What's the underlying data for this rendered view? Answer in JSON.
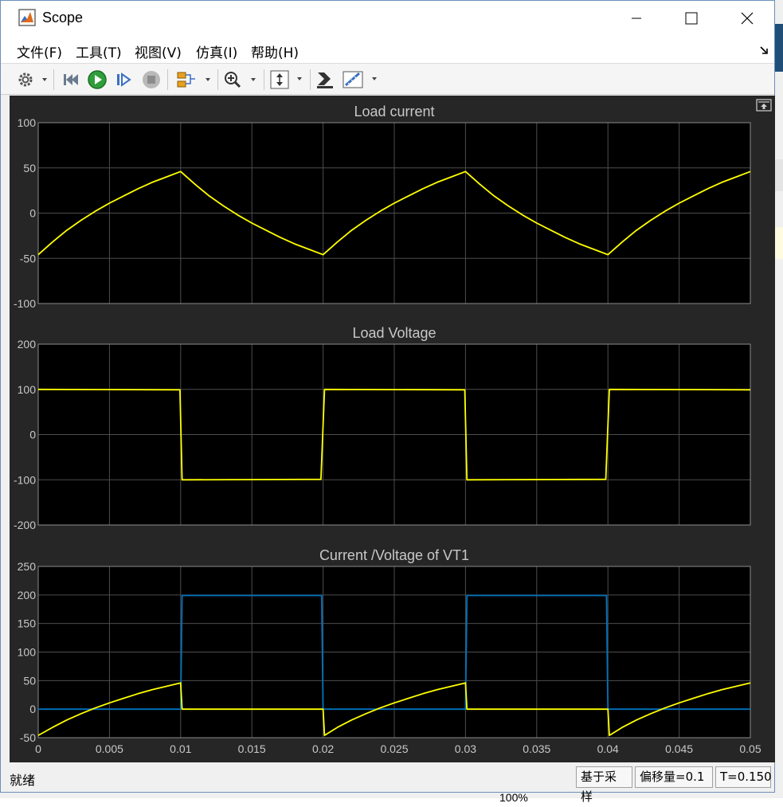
{
  "window": {
    "title": "Scope",
    "minimize_glyph": "—",
    "maximize_glyph": "☐",
    "close_glyph": "✕"
  },
  "background": {
    "bottom_text": "100%"
  },
  "menu": [
    {
      "label": "文件(F)"
    },
    {
      "label": "工具(T)"
    },
    {
      "label": "视图(V)"
    },
    {
      "label": "仿真(I)"
    },
    {
      "label": "帮助(H)"
    }
  ],
  "toolbar": {
    "icons": [
      "gear-icon",
      "step-back-icon",
      "run-icon",
      "step-forward-icon",
      "stop-icon",
      "signal-selector-icon",
      "zoom-icon",
      "autoscale-icon",
      "style-icon",
      "measurements-icon"
    ]
  },
  "status": {
    "text": "就绪",
    "sample_based": "基于采样",
    "offset": "偏移量=0.1",
    "time": "T=0.150"
  },
  "colors": {
    "plot_bg": "#000000",
    "figure_bg": "#262626",
    "grid": "#4d4d4d",
    "series_yellow": "#ffff00",
    "series_blue": "#0072bd",
    "text": "#c8c8c8"
  },
  "chart_data": [
    {
      "type": "line",
      "title": "Load current",
      "xlim": [
        0,
        0.05
      ],
      "ylim": [
        -100,
        100
      ],
      "yticks": [
        "100",
        "50",
        "0",
        "-50",
        "-100"
      ],
      "ytick_values": [
        100,
        50,
        0,
        -50,
        -100
      ],
      "xticks": [],
      "grid": true,
      "series": [
        {
          "color": "#ffff00",
          "x": [
            0,
            0.001,
            0.002,
            0.003,
            0.004,
            0.005,
            0.006,
            0.007,
            0.008,
            0.009,
            0.01,
            0.011,
            0.012,
            0.013,
            0.014,
            0.015,
            0.016,
            0.017,
            0.018,
            0.019,
            0.02,
            0.021,
            0.022,
            0.023,
            0.024,
            0.025,
            0.026,
            0.027,
            0.028,
            0.029,
            0.03,
            0.031,
            0.032,
            0.033,
            0.034,
            0.035,
            0.036,
            0.037,
            0.038,
            0.039,
            0.04,
            0.041,
            0.042,
            0.043,
            0.044,
            0.045,
            0.046,
            0.047,
            0.048,
            0.049,
            0.05
          ],
          "y": [
            -46,
            -32,
            -19,
            -8,
            2,
            11,
            19,
            27,
            34,
            40,
            46,
            32,
            19,
            8,
            -2,
            -11,
            -19,
            -27,
            -34,
            -40,
            -46,
            -32,
            -19,
            -8,
            2,
            11,
            19,
            27,
            34,
            40,
            46,
            32,
            19,
            8,
            -2,
            -11,
            -19,
            -27,
            -34,
            -40,
            -46,
            -32,
            -19,
            -8,
            2,
            11,
            19,
            27,
            34,
            40,
            46
          ]
        }
      ]
    },
    {
      "type": "line",
      "title": "Load Voltage",
      "xlim": [
        0,
        0.05
      ],
      "ylim": [
        -200,
        200
      ],
      "yticks": [
        "200",
        "100",
        "0",
        "-100",
        "-200"
      ],
      "ytick_values": [
        200,
        100,
        0,
        -100,
        -200
      ],
      "xticks": [],
      "grid": true,
      "series": [
        {
          "color": "#ffff00",
          "x": [
            0,
            0.00995,
            0.0101,
            0.01985,
            0.0201,
            0.02995,
            0.0301,
            0.03985,
            0.0401,
            0.05
          ],
          "y": [
            100,
            99,
            -100,
            -99,
            100,
            99,
            -100,
            -99,
            100,
            99
          ]
        }
      ]
    },
    {
      "type": "line",
      "title": "Current /Voltage of VT1",
      "xlim": [
        0,
        0.05
      ],
      "ylim": [
        -50,
        250
      ],
      "yticks": [
        "250",
        "200",
        "150",
        "100",
        "50",
        "0",
        "-50"
      ],
      "ytick_values": [
        250,
        200,
        150,
        100,
        50,
        0,
        -50
      ],
      "xticks": [
        "0",
        "0.005",
        "0.01",
        "0.015",
        "0.02",
        "0.025",
        "0.03",
        "0.035",
        "0.04",
        "0.045",
        "0.05"
      ],
      "xtick_values": [
        0,
        0.005,
        0.01,
        0.015,
        0.02,
        0.025,
        0.03,
        0.035,
        0.04,
        0.045,
        0.05
      ],
      "grid": true,
      "series": [
        {
          "color": "#0072bd",
          "x": [
            0,
            0.01,
            0.0101,
            0.0199,
            0.02,
            0.03,
            0.0301,
            0.0399,
            0.04,
            0.05
          ],
          "y": [
            0,
            0,
            199,
            199,
            0,
            0,
            199,
            199,
            0,
            0
          ]
        },
        {
          "color": "#ffff00",
          "x": [
            0,
            0.001,
            0.002,
            0.003,
            0.004,
            0.005,
            0.006,
            0.007,
            0.008,
            0.009,
            0.01,
            0.0101,
            0.02,
            0.0201,
            0.021,
            0.022,
            0.023,
            0.024,
            0.025,
            0.026,
            0.027,
            0.028,
            0.029,
            0.03,
            0.0301,
            0.04,
            0.0401,
            0.041,
            0.042,
            0.043,
            0.044,
            0.045,
            0.046,
            0.047,
            0.048,
            0.049,
            0.05
          ],
          "y": [
            -46,
            -32,
            -19,
            -8,
            2,
            11,
            19,
            27,
            34,
            40,
            46,
            0,
            0,
            -46,
            -32,
            -19,
            -8,
            2,
            11,
            19,
            27,
            34,
            40,
            46,
            0,
            0,
            -46,
            -32,
            -19,
            -8,
            2,
            11,
            19,
            27,
            34,
            40,
            46
          ]
        }
      ]
    }
  ]
}
